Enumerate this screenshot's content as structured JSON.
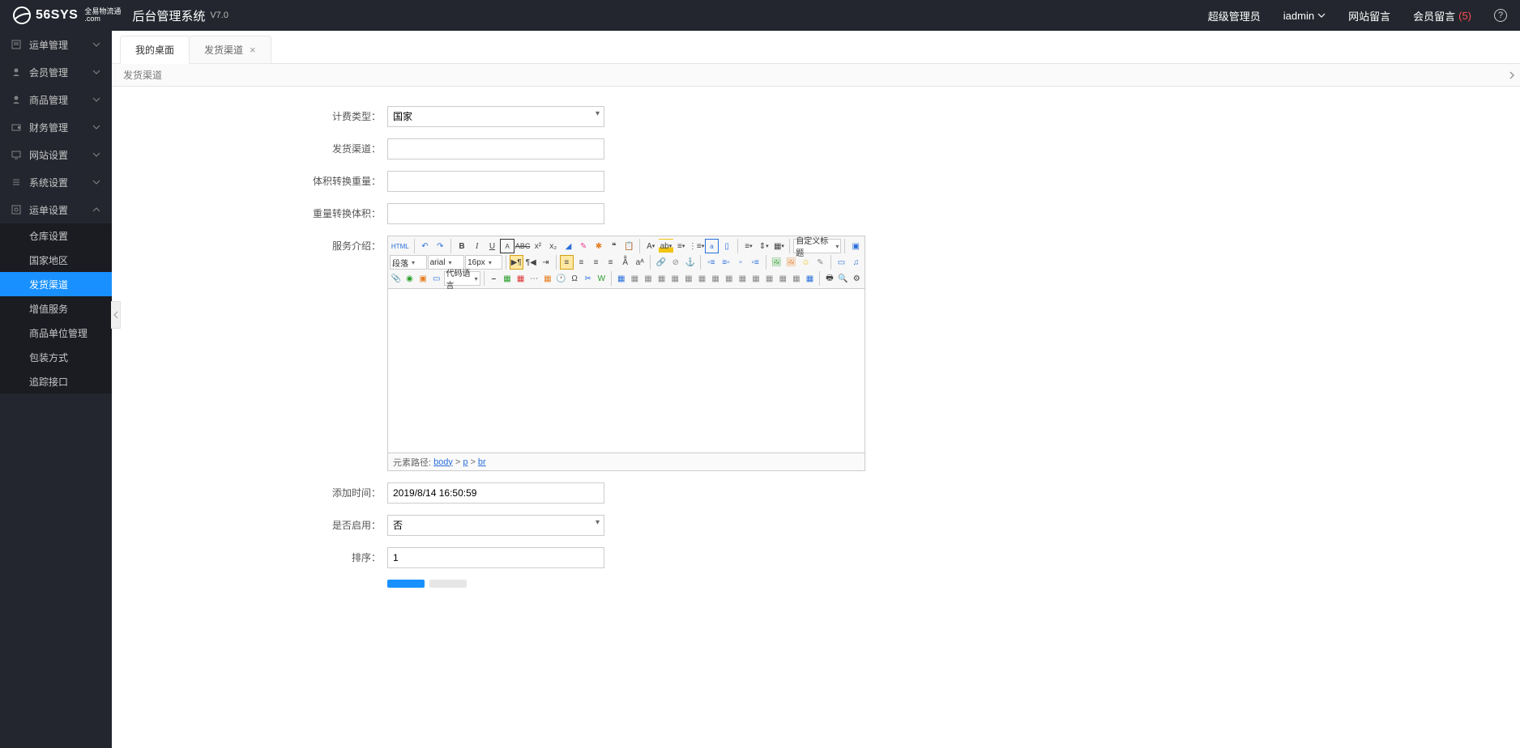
{
  "header": {
    "logo_main": "56SYS",
    "logo_sub_top": "全易物流通",
    "logo_sub_bot": ".com",
    "title": "后台管理系统",
    "version": "V7.0",
    "admin_role": "超级管理员",
    "admin_name": "iadmin",
    "site_msg": "网站留言",
    "member_msg": "会员留言",
    "member_msg_count": "(5)"
  },
  "sidebar": {
    "items": [
      {
        "label": "运单管理",
        "expanded": false
      },
      {
        "label": "会员管理",
        "expanded": false
      },
      {
        "label": "商品管理",
        "expanded": false
      },
      {
        "label": "财务管理",
        "expanded": false
      },
      {
        "label": "网站设置",
        "expanded": false
      },
      {
        "label": "系统设置",
        "expanded": false
      },
      {
        "label": "运单设置",
        "expanded": true
      }
    ],
    "submenu": [
      {
        "label": "仓库设置",
        "active": false
      },
      {
        "label": "国家地区",
        "active": false
      },
      {
        "label": "发货渠道",
        "active": true
      },
      {
        "label": "增值服务",
        "active": false
      },
      {
        "label": "商品单位管理",
        "active": false
      },
      {
        "label": "包装方式",
        "active": false
      },
      {
        "label": "追踪接口",
        "active": false
      }
    ]
  },
  "tabs": [
    {
      "label": "我的桌面",
      "closable": false,
      "active": true
    },
    {
      "label": "发货渠道",
      "closable": true,
      "active": false
    }
  ],
  "breadcrumb": "发货渠道",
  "form": {
    "billing_type_label": "计费类型：",
    "billing_type_value": "国家",
    "channel_label": "发货渠道：",
    "channel_value": "",
    "vol_weight_label": "体积转换重量：",
    "vol_weight_value": "",
    "weight_vol_label": "重量转换体积：",
    "weight_vol_value": "",
    "service_intro_label": "服务介绍：",
    "add_time_label": "添加时间：",
    "add_time_value": "2019/8/14 16:50:59",
    "enabled_label": "是否启用：",
    "enabled_value": "否",
    "sort_label": "排序：",
    "sort_value": "1"
  },
  "editor": {
    "dd_paragraph": "段落",
    "dd_font": "arial",
    "dd_size": "16px",
    "dd_title": "自定义标题",
    "dd_codelang": "代码语言",
    "footer_label": "元素路径:",
    "path": [
      "body",
      "p",
      "br"
    ]
  }
}
